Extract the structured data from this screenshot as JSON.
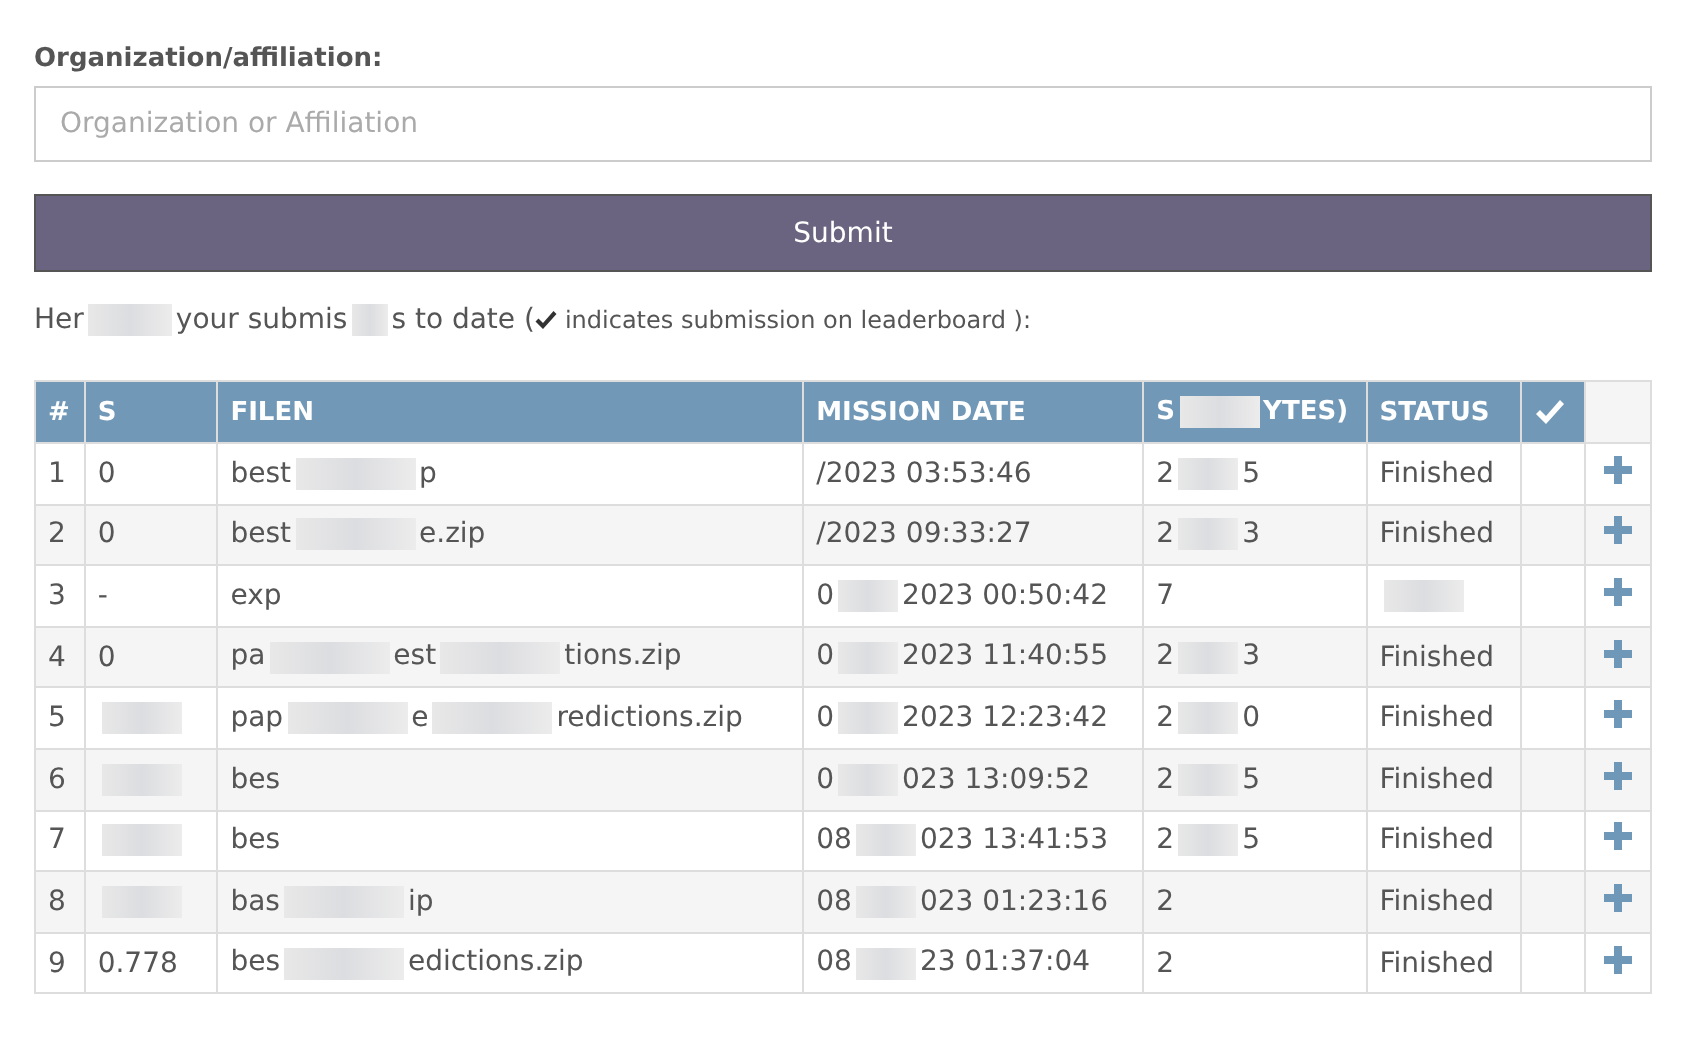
{
  "form": {
    "label": "Organization/affiliation:",
    "field": {
      "placeholder": "Organization or Affiliation"
    },
    "submit": "Submit"
  },
  "intro": {
    "parts": [
      "Her",
      "your submis",
      "s to date ("
    ],
    "note": "indicates submission on leaderboard ):"
  },
  "table": {
    "columns": [
      {
        "parts": [
          "#"
        ]
      },
      {
        "parts": [
          "S"
        ]
      },
      {
        "parts": [
          "FILEN"
        ]
      },
      {
        "parts": [
          "MISSION DATE"
        ]
      },
      {
        "parts": [
          "S",
          "YTES)"
        ]
      },
      {
        "parts": [
          "STATUS"
        ]
      }
    ],
    "rows": [
      {
        "number": "1",
        "score": [
          "0"
        ],
        "filename": [
          "best",
          "p"
        ],
        "date": [
          "/2023 03:53:46"
        ],
        "size": [
          "2",
          "5"
        ],
        "status": [
          "Finished"
        ]
      },
      {
        "number": "2",
        "score": [
          "0"
        ],
        "filename": [
          "best",
          "e.zip"
        ],
        "date": [
          "/2023 09:33:27"
        ],
        "size": [
          "2",
          "3"
        ],
        "status": [
          "Finished"
        ]
      },
      {
        "number": "3",
        "score": [
          "-"
        ],
        "filename": [
          "exp"
        ],
        "date": [
          "0",
          "2023 00:50:42"
        ],
        "size": [
          "7"
        ],
        "status": []
      },
      {
        "number": "4",
        "score": [
          "0"
        ],
        "filename": [
          "pa",
          "est",
          "tions.zip"
        ],
        "date": [
          "0",
          "2023 11:40:55"
        ],
        "size": [
          "2",
          "3"
        ],
        "status": [
          "Finished"
        ]
      },
      {
        "number": "5",
        "score": [],
        "filename": [
          "pap",
          "e",
          "redictions.zip"
        ],
        "date": [
          "0",
          "2023 12:23:42"
        ],
        "size": [
          "2",
          "0"
        ],
        "status": [
          "Finished"
        ]
      },
      {
        "number": "6",
        "score": [],
        "filename": [
          "bes"
        ],
        "date": [
          "0",
          "023 13:09:52"
        ],
        "size": [
          "2",
          "5"
        ],
        "status": [
          "Finished"
        ]
      },
      {
        "number": "7",
        "score": [],
        "filename": [
          "bes"
        ],
        "date": [
          "08",
          "023 13:41:53"
        ],
        "size": [
          "2",
          "5"
        ],
        "status": [
          "Finished"
        ]
      },
      {
        "number": "8",
        "score": [],
        "filename": [
          "bas",
          "ip"
        ],
        "date": [
          "08",
          "023 01:23:16"
        ],
        "size": [
          "2"
        ],
        "status": [
          "Finished"
        ]
      },
      {
        "number": "9",
        "score": [
          "0.778"
        ],
        "filename": [
          "bes",
          "edictions.zip"
        ],
        "date": [
          "08",
          "23 01:37:04"
        ],
        "size": [
          "2"
        ],
        "status": [
          "Finished"
        ]
      }
    ]
  }
}
